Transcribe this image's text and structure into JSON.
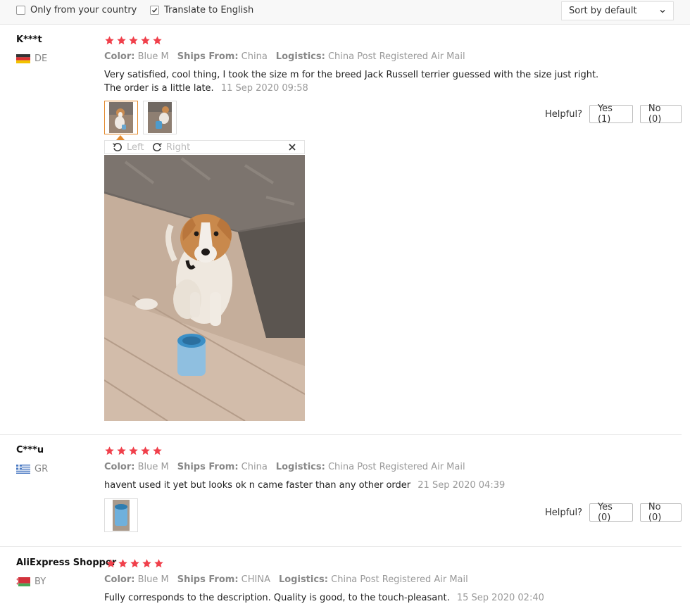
{
  "filters": {
    "only_country_label": "Only from your country",
    "only_country_checked": false,
    "translate_label": "Translate to English",
    "translate_checked": true,
    "sort_label": "Sort by default"
  },
  "viewer": {
    "rotate_left": "Left",
    "rotate_right": "Right"
  },
  "colors": {
    "star": "#f0404b",
    "selected_thumb": "#e38a2d"
  },
  "reviews": [
    {
      "user": "K***t",
      "country": "DE",
      "rating": 5,
      "color_label": "Color:",
      "color": "Blue M",
      "ships_label": "Ships From:",
      "ships": "China",
      "logistics_label": "Logistics:",
      "logistics": "China Post Registered Air Mail",
      "text": "Very satisfied, cool thing, I took the size m for the breed Jack Russell terrier guessed with the size just right. The order is a little late.",
      "date": "11 Sep 2020 09:58",
      "helpful_label": "Helpful?",
      "yes": "Yes (1)",
      "no": "No (0)"
    },
    {
      "user": "C***u",
      "country": "GR",
      "rating": 5,
      "color_label": "Color:",
      "color": "Blue M",
      "ships_label": "Ships From:",
      "ships": "China",
      "logistics_label": "Logistics:",
      "logistics": "China Post Registered Air Mail",
      "text": "havent used it yet but looks ok n came faster than any other order",
      "date": "21 Sep 2020 04:39",
      "helpful_label": "Helpful?",
      "yes": "Yes (0)",
      "no": "No (0)"
    },
    {
      "user": "AliExpress Shopper",
      "country": "BY",
      "rating": 5,
      "color_label": "Color:",
      "color": "Blue M",
      "ships_label": "Ships From:",
      "ships": "CHINA",
      "logistics_label": "Logistics:",
      "logistics": "China Post Registered Air Mail",
      "text": "Fully corresponds to the description. Quality is good, to the touch-pleasant.",
      "date": "15 Sep 2020 02:40"
    }
  ]
}
